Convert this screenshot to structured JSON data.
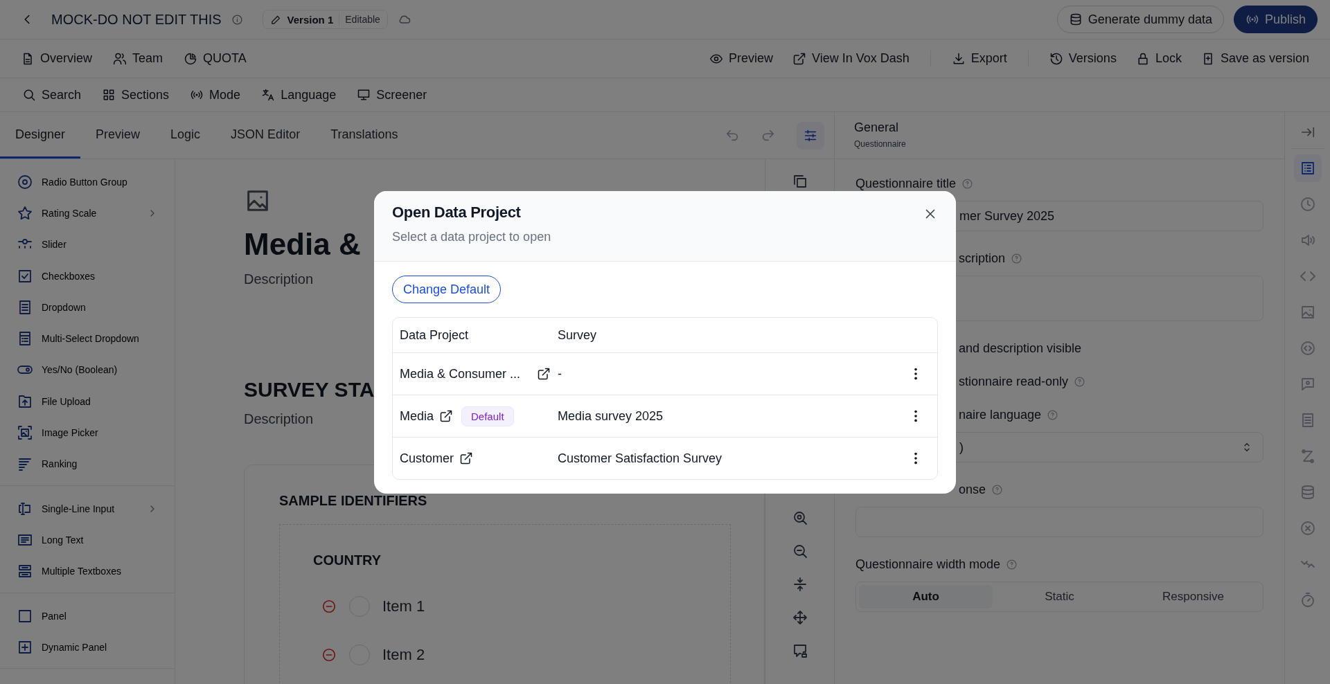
{
  "top_bar": {
    "title": "MOCK-DO NOT EDIT THIS",
    "version": "Version 1",
    "status": "Editable",
    "buttons": [
      {
        "label": "Generate dummy data",
        "kind": "secondary"
      },
      {
        "label": "Publish",
        "kind": "primary"
      }
    ]
  },
  "nav": {
    "left": [
      "Overview",
      "Team",
      "QUOTA"
    ],
    "right": [
      [
        "Preview",
        "View In Vox Dash"
      ],
      [
        "Export"
      ],
      [
        "Versions",
        "Lock",
        "Save as version"
      ]
    ]
  },
  "tools": [
    "Search",
    "Sections",
    "Mode",
    "Language",
    "Screener"
  ],
  "tabs": [
    {
      "label": "Designer",
      "selected": true
    },
    {
      "label": "Preview",
      "selected": false
    },
    {
      "label": "Logic",
      "selected": false
    },
    {
      "label": "JSON Editor",
      "selected": false
    },
    {
      "label": "Translations",
      "selected": false
    }
  ],
  "toolbox": [
    [
      {
        "label": "Radio Button Group",
        "submenu": false
      },
      {
        "label": "Rating Scale",
        "submenu": true
      },
      {
        "label": "Slider",
        "submenu": false
      },
      {
        "label": "Checkboxes",
        "submenu": false
      },
      {
        "label": "Dropdown",
        "submenu": false
      },
      {
        "label": "Multi-Select Dropdown",
        "submenu": false
      },
      {
        "label": "Yes/No (Boolean)",
        "submenu": false
      },
      {
        "label": "File Upload",
        "submenu": false
      },
      {
        "label": "Image Picker",
        "submenu": false
      },
      {
        "label": "Ranking",
        "submenu": false
      }
    ],
    [
      {
        "label": "Single-Line Input",
        "submenu": true
      },
      {
        "label": "Long Text",
        "submenu": false
      },
      {
        "label": "Multiple Textboxes",
        "submenu": false
      }
    ],
    [
      {
        "label": "Panel",
        "submenu": false
      },
      {
        "label": "Dynamic Panel",
        "submenu": false
      }
    ]
  ],
  "canvas": {
    "title": "Media &",
    "description": "Description",
    "page_title": "SURVEY STA",
    "page_description": "Description",
    "panel": {
      "title": "SAMPLE IDENTIFIERS",
      "question": "COUNTRY",
      "choices": [
        {
          "label": "Item 1",
          "selected": false
        },
        {
          "label": "Item 2",
          "selected": false
        }
      ]
    }
  },
  "properties": {
    "title": "General",
    "subtitle": "Questionnaire",
    "rows": [
      {
        "kind": "text",
        "label": "Questionnaire title",
        "help": true,
        "partly_hidden": false
      },
      {
        "kind": "input",
        "value": "mer Survey 2025",
        "partly_hidden": true
      },
      {
        "kind": "text",
        "label": "scription",
        "help": true,
        "partly_hidden": true
      },
      {
        "kind": "textarea"
      },
      {
        "kind": "check",
        "label": "and description visible",
        "help": false,
        "partly_hidden": true
      },
      {
        "kind": "check",
        "label": "stionnaire read-only",
        "help": true,
        "partly_hidden": true
      },
      {
        "kind": "text",
        "label": "naire language",
        "help": true,
        "partly_hidden": true
      },
      {
        "kind": "select",
        "value": ")",
        "partly_hidden": true
      },
      {
        "kind": "text",
        "label": "onse",
        "help": true,
        "partly_hidden": true
      },
      {
        "kind": "input"
      },
      {
        "kind": "text",
        "label": "Questionnaire width mode",
        "help": true,
        "partly_hidden": false
      },
      {
        "kind": "segmented",
        "options": [
          {
            "label": "Auto",
            "selected": true
          },
          {
            "label": "Static",
            "selected": false
          },
          {
            "label": "Responsive",
            "selected": false
          }
        ]
      }
    ]
  },
  "rail": [
    {
      "selected": false
    },
    {
      "selected": true
    },
    {
      "selected": false
    },
    {
      "selected": false
    },
    {
      "selected": false
    },
    {
      "selected": false
    },
    {
      "selected": false
    },
    {
      "selected": false
    },
    {
      "selected": false
    },
    {
      "selected": false
    },
    {
      "selected": false
    },
    {
      "selected": false
    },
    {
      "selected": false
    },
    {
      "selected": false
    }
  ],
  "dialog": {
    "title": "Open Data Project",
    "subtitle": "Select a data project to open",
    "action": "Change Default",
    "columns": [
      "Data Project",
      "Survey"
    ],
    "rows": [
      {
        "data_project": "Media & Consumer ...",
        "survey": "-"
      },
      {
        "data_project": "Media",
        "badge": "Default",
        "survey": "Media survey 2025"
      },
      {
        "data_project": "Customer",
        "survey": "Customer Satisfaction Survey"
      }
    ]
  }
}
